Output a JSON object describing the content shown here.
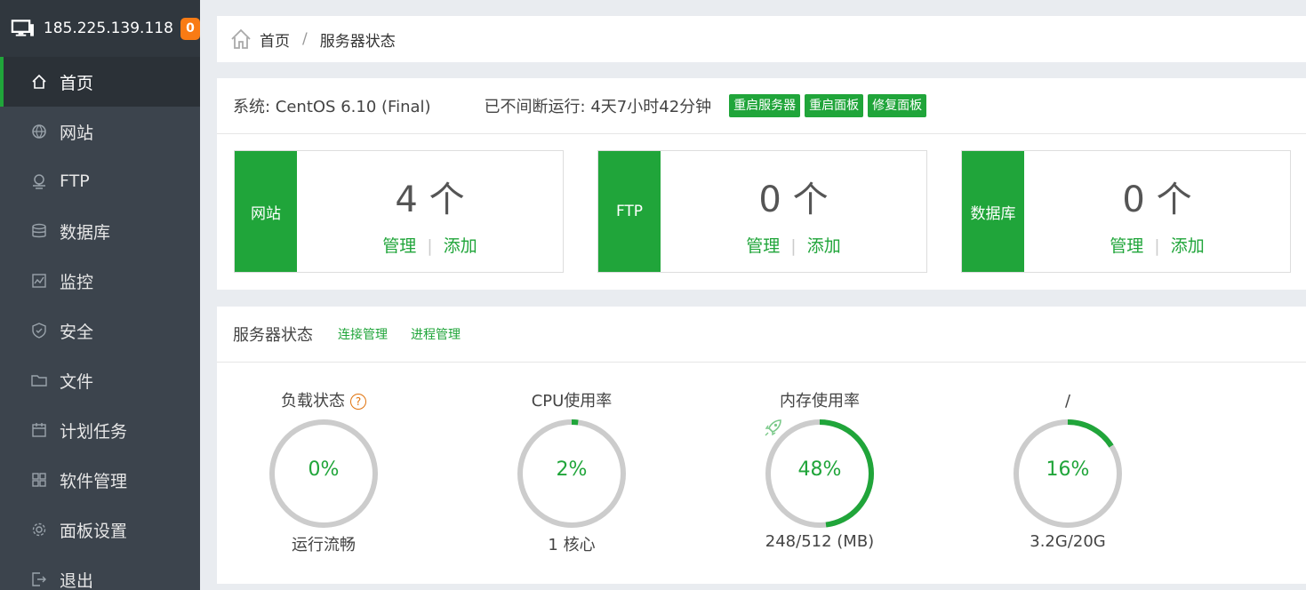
{
  "header": {
    "ip": "185.225.139.118",
    "badge": "0"
  },
  "nav": [
    {
      "label": "首页",
      "icon": "home-icon",
      "active": true
    },
    {
      "label": "网站",
      "icon": "globe-icon"
    },
    {
      "label": "FTP",
      "icon": "ftp-icon"
    },
    {
      "label": "数据库",
      "icon": "database-icon"
    },
    {
      "label": "监控",
      "icon": "monitor-icon"
    },
    {
      "label": "安全",
      "icon": "shield-icon"
    },
    {
      "label": "文件",
      "icon": "folder-icon"
    },
    {
      "label": "计划任务",
      "icon": "calendar-icon"
    },
    {
      "label": "软件管理",
      "icon": "apps-icon"
    },
    {
      "label": "面板设置",
      "icon": "gear-icon"
    },
    {
      "label": "退出",
      "icon": "logout-icon"
    }
  ],
  "breadcrumb": {
    "home": "首页",
    "separator": "/",
    "current": "服务器状态"
  },
  "system": {
    "os": "系统: CentOS 6.10 (Final)",
    "uptime": "已不间断运行: 4天7小时42分钟",
    "buttons": {
      "restart_server": "重启服务器",
      "restart_panel": "重启面板",
      "repair_panel": "修复面板"
    }
  },
  "cards": [
    {
      "label": "网站",
      "count": "4 个",
      "manage": "管理",
      "divider": "|",
      "add": "添加"
    },
    {
      "label": "FTP",
      "count": "0 个",
      "manage": "管理",
      "divider": "|",
      "add": "添加"
    },
    {
      "label": "数据库",
      "count": "0 个",
      "manage": "管理",
      "divider": "|",
      "add": "添加"
    }
  ],
  "status": {
    "title": "服务器状态",
    "links": {
      "connections": "连接管理",
      "processes": "进程管理"
    },
    "gauges": [
      {
        "title": "负载状态",
        "help": "?",
        "value": "0%",
        "percent": 0,
        "sub": "运行流畅"
      },
      {
        "title": "CPU使用率",
        "value": "2%",
        "percent": 2,
        "sub": "1 核心"
      },
      {
        "title": "内存使用率",
        "value": "48%",
        "percent": 48,
        "sub": "248/512 (MB)",
        "icon": "rocket-icon"
      },
      {
        "title": "/",
        "value": "16%",
        "percent": 16,
        "sub": "3.2G/20G"
      }
    ]
  },
  "colors": {
    "accent": "#20a53a",
    "sidebar": "#3c444d",
    "badge": "#f97b14",
    "ring_track": "#cccccc"
  }
}
